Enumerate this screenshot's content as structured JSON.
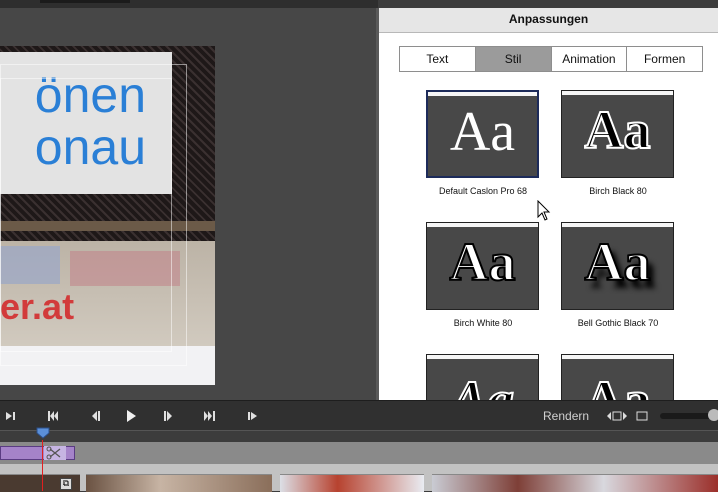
{
  "panel": {
    "title": "Anpassungen",
    "tabs": [
      {
        "label": "Text",
        "active": false
      },
      {
        "label": "Stil",
        "active": true
      },
      {
        "label": "Animation",
        "active": false
      },
      {
        "label": "Formen",
        "active": false
      }
    ],
    "styles": [
      {
        "label": "Default Caslon Pro 68",
        "sample": "Aa",
        "selected": true
      },
      {
        "label": "Birch Black 80",
        "sample": "Aa",
        "selected": false
      },
      {
        "label": "Birch White 80",
        "sample": "Aa",
        "selected": false
      },
      {
        "label": "Bell Gothic Black 70",
        "sample": "Aa",
        "selected": false
      },
      {
        "label": "",
        "sample": "Aa",
        "selected": false
      },
      {
        "label": "",
        "sample": "Aa",
        "selected": false
      }
    ]
  },
  "monitor": {
    "title_line1": "önen",
    "title_line2": "onau",
    "graffiti_text": "er.at"
  },
  "transport": {
    "buttons": [
      {
        "name": "mark-in",
        "glyph": "⏴|"
      },
      {
        "name": "go-to-start",
        "glyph": "⏮"
      },
      {
        "name": "step-back",
        "glyph": "⏴|"
      },
      {
        "name": "play",
        "glyph": "▶"
      },
      {
        "name": "step-forward",
        "glyph": "|⏵"
      },
      {
        "name": "go-to-end",
        "glyph": "⏭"
      },
      {
        "name": "mark-out",
        "glyph": "|⏵"
      }
    ],
    "render_label": "Rendern"
  },
  "colors": {
    "title_text": "#2a7fd6",
    "active_tab": "#9b9b9b",
    "clip": "#a583c9",
    "playhead": "#e02020"
  }
}
